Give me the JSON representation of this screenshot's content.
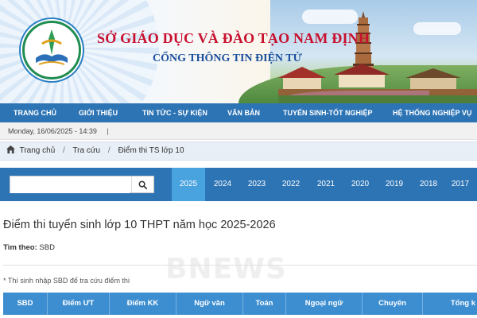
{
  "header": {
    "title": "SỞ GIÁO DỤC VÀ ĐÀO TẠO NAM ĐỊNH",
    "subtitle": "CỔNG THÔNG TIN ĐIỆN TỬ",
    "colors": {
      "title": "#c8102e",
      "subtitle": "#1a4f9c"
    }
  },
  "nav": {
    "items": [
      {
        "label": "TRANG CHỦ"
      },
      {
        "label": "GIỚI THIỆU"
      },
      {
        "label": "TIN TỨC - SỰ KIỆN"
      },
      {
        "label": "VĂN BẢN"
      },
      {
        "label": "TUYỂN SINH-TỐT NGHIỆP"
      },
      {
        "label": "HỆ THỐNG NGHIỆP VỤ"
      }
    ],
    "color": "#2d74b5"
  },
  "datebar": {
    "datetime": "Monday, 16/06/2025 - 14:39",
    "separator": "|"
  },
  "breadcrumb": {
    "icon": "home-icon",
    "items": [
      {
        "label": "Trang chủ"
      },
      {
        "label": "Tra cứu"
      },
      {
        "label": "Điểm thi TS lớp 10"
      }
    ],
    "separator": "/"
  },
  "search": {
    "value": "",
    "icon": "search-icon"
  },
  "years": {
    "items": [
      "2025",
      "2024",
      "2023",
      "2022",
      "2021",
      "2020",
      "2019",
      "2018",
      "2017"
    ],
    "active": "2025",
    "active_color": "#49a3df"
  },
  "main": {
    "title": "Điểm thi tuyển sinh lớp 10 THPT năm học 2025-2026",
    "filter_label": "Tìm theo:",
    "filter_value": "SBD",
    "note": "* Thí sinh nhập SBD để tra cứu điểm thi"
  },
  "table": {
    "headers": [
      "SBD",
      "Điểm ƯT",
      "Điểm KK",
      "Ngữ văn",
      "Toán",
      "Ngoại ngữ",
      "Chuyên",
      "Tổng k"
    ],
    "header_color": "#3d8ed0"
  },
  "watermark": "BNEWS"
}
